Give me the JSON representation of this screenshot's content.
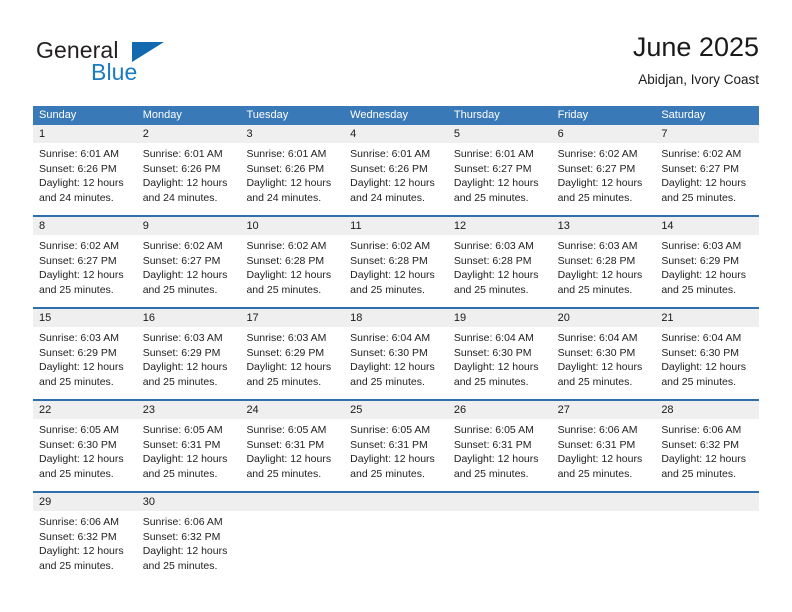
{
  "brand": {
    "name_top": "General",
    "name_bottom": "Blue",
    "triangle_icon": "triangle-icon",
    "color_dark": "#231f20",
    "color_blue": "#1a7ac4"
  },
  "header": {
    "title": "June 2025",
    "subtitle": "Abidjan, Ivory Coast"
  },
  "theme": {
    "header_bg": "#3a79b8",
    "header_text": "#ffffff",
    "daynum_bg": "#efefef",
    "row_divider": "#2f6fae",
    "cell_bg": "#ffffff",
    "body_text": "#222222"
  },
  "calendar": {
    "weekdays": [
      "Sunday",
      "Monday",
      "Tuesday",
      "Wednesday",
      "Thursday",
      "Friday",
      "Saturday"
    ],
    "weeks": [
      [
        {
          "day": "1",
          "sunrise": "Sunrise: 6:01 AM",
          "sunset": "Sunset: 6:26 PM",
          "daylight_1": "Daylight: 12 hours",
          "daylight_2": "and 24 minutes."
        },
        {
          "day": "2",
          "sunrise": "Sunrise: 6:01 AM",
          "sunset": "Sunset: 6:26 PM",
          "daylight_1": "Daylight: 12 hours",
          "daylight_2": "and 24 minutes."
        },
        {
          "day": "3",
          "sunrise": "Sunrise: 6:01 AM",
          "sunset": "Sunset: 6:26 PM",
          "daylight_1": "Daylight: 12 hours",
          "daylight_2": "and 24 minutes."
        },
        {
          "day": "4",
          "sunrise": "Sunrise: 6:01 AM",
          "sunset": "Sunset: 6:26 PM",
          "daylight_1": "Daylight: 12 hours",
          "daylight_2": "and 24 minutes."
        },
        {
          "day": "5",
          "sunrise": "Sunrise: 6:01 AM",
          "sunset": "Sunset: 6:27 PM",
          "daylight_1": "Daylight: 12 hours",
          "daylight_2": "and 25 minutes."
        },
        {
          "day": "6",
          "sunrise": "Sunrise: 6:02 AM",
          "sunset": "Sunset: 6:27 PM",
          "daylight_1": "Daylight: 12 hours",
          "daylight_2": "and 25 minutes."
        },
        {
          "day": "7",
          "sunrise": "Sunrise: 6:02 AM",
          "sunset": "Sunset: 6:27 PM",
          "daylight_1": "Daylight: 12 hours",
          "daylight_2": "and 25 minutes."
        }
      ],
      [
        {
          "day": "8",
          "sunrise": "Sunrise: 6:02 AM",
          "sunset": "Sunset: 6:27 PM",
          "daylight_1": "Daylight: 12 hours",
          "daylight_2": "and 25 minutes."
        },
        {
          "day": "9",
          "sunrise": "Sunrise: 6:02 AM",
          "sunset": "Sunset: 6:27 PM",
          "daylight_1": "Daylight: 12 hours",
          "daylight_2": "and 25 minutes."
        },
        {
          "day": "10",
          "sunrise": "Sunrise: 6:02 AM",
          "sunset": "Sunset: 6:28 PM",
          "daylight_1": "Daylight: 12 hours",
          "daylight_2": "and 25 minutes."
        },
        {
          "day": "11",
          "sunrise": "Sunrise: 6:02 AM",
          "sunset": "Sunset: 6:28 PM",
          "daylight_1": "Daylight: 12 hours",
          "daylight_2": "and 25 minutes."
        },
        {
          "day": "12",
          "sunrise": "Sunrise: 6:03 AM",
          "sunset": "Sunset: 6:28 PM",
          "daylight_1": "Daylight: 12 hours",
          "daylight_2": "and 25 minutes."
        },
        {
          "day": "13",
          "sunrise": "Sunrise: 6:03 AM",
          "sunset": "Sunset: 6:28 PM",
          "daylight_1": "Daylight: 12 hours",
          "daylight_2": "and 25 minutes."
        },
        {
          "day": "14",
          "sunrise": "Sunrise: 6:03 AM",
          "sunset": "Sunset: 6:29 PM",
          "daylight_1": "Daylight: 12 hours",
          "daylight_2": "and 25 minutes."
        }
      ],
      [
        {
          "day": "15",
          "sunrise": "Sunrise: 6:03 AM",
          "sunset": "Sunset: 6:29 PM",
          "daylight_1": "Daylight: 12 hours",
          "daylight_2": "and 25 minutes."
        },
        {
          "day": "16",
          "sunrise": "Sunrise: 6:03 AM",
          "sunset": "Sunset: 6:29 PM",
          "daylight_1": "Daylight: 12 hours",
          "daylight_2": "and 25 minutes."
        },
        {
          "day": "17",
          "sunrise": "Sunrise: 6:03 AM",
          "sunset": "Sunset: 6:29 PM",
          "daylight_1": "Daylight: 12 hours",
          "daylight_2": "and 25 minutes."
        },
        {
          "day": "18",
          "sunrise": "Sunrise: 6:04 AM",
          "sunset": "Sunset: 6:30 PM",
          "daylight_1": "Daylight: 12 hours",
          "daylight_2": "and 25 minutes."
        },
        {
          "day": "19",
          "sunrise": "Sunrise: 6:04 AM",
          "sunset": "Sunset: 6:30 PM",
          "daylight_1": "Daylight: 12 hours",
          "daylight_2": "and 25 minutes."
        },
        {
          "day": "20",
          "sunrise": "Sunrise: 6:04 AM",
          "sunset": "Sunset: 6:30 PM",
          "daylight_1": "Daylight: 12 hours",
          "daylight_2": "and 25 minutes."
        },
        {
          "day": "21",
          "sunrise": "Sunrise: 6:04 AM",
          "sunset": "Sunset: 6:30 PM",
          "daylight_1": "Daylight: 12 hours",
          "daylight_2": "and 25 minutes."
        }
      ],
      [
        {
          "day": "22",
          "sunrise": "Sunrise: 6:05 AM",
          "sunset": "Sunset: 6:30 PM",
          "daylight_1": "Daylight: 12 hours",
          "daylight_2": "and 25 minutes."
        },
        {
          "day": "23",
          "sunrise": "Sunrise: 6:05 AM",
          "sunset": "Sunset: 6:31 PM",
          "daylight_1": "Daylight: 12 hours",
          "daylight_2": "and 25 minutes."
        },
        {
          "day": "24",
          "sunrise": "Sunrise: 6:05 AM",
          "sunset": "Sunset: 6:31 PM",
          "daylight_1": "Daylight: 12 hours",
          "daylight_2": "and 25 minutes."
        },
        {
          "day": "25",
          "sunrise": "Sunrise: 6:05 AM",
          "sunset": "Sunset: 6:31 PM",
          "daylight_1": "Daylight: 12 hours",
          "daylight_2": "and 25 minutes."
        },
        {
          "day": "26",
          "sunrise": "Sunrise: 6:05 AM",
          "sunset": "Sunset: 6:31 PM",
          "daylight_1": "Daylight: 12 hours",
          "daylight_2": "and 25 minutes."
        },
        {
          "day": "27",
          "sunrise": "Sunrise: 6:06 AM",
          "sunset": "Sunset: 6:31 PM",
          "daylight_1": "Daylight: 12 hours",
          "daylight_2": "and 25 minutes."
        },
        {
          "day": "28",
          "sunrise": "Sunrise: 6:06 AM",
          "sunset": "Sunset: 6:32 PM",
          "daylight_1": "Daylight: 12 hours",
          "daylight_2": "and 25 minutes."
        }
      ],
      [
        {
          "day": "29",
          "sunrise": "Sunrise: 6:06 AM",
          "sunset": "Sunset: 6:32 PM",
          "daylight_1": "Daylight: 12 hours",
          "daylight_2": "and 25 minutes."
        },
        {
          "day": "30",
          "sunrise": "Sunrise: 6:06 AM",
          "sunset": "Sunset: 6:32 PM",
          "daylight_1": "Daylight: 12 hours",
          "daylight_2": "and 25 minutes."
        },
        {
          "day": "",
          "sunrise": "",
          "sunset": "",
          "daylight_1": "",
          "daylight_2": ""
        },
        {
          "day": "",
          "sunrise": "",
          "sunset": "",
          "daylight_1": "",
          "daylight_2": ""
        },
        {
          "day": "",
          "sunrise": "",
          "sunset": "",
          "daylight_1": "",
          "daylight_2": ""
        },
        {
          "day": "",
          "sunrise": "",
          "sunset": "",
          "daylight_1": "",
          "daylight_2": ""
        },
        {
          "day": "",
          "sunrise": "",
          "sunset": "",
          "daylight_1": "",
          "daylight_2": ""
        }
      ]
    ]
  }
}
